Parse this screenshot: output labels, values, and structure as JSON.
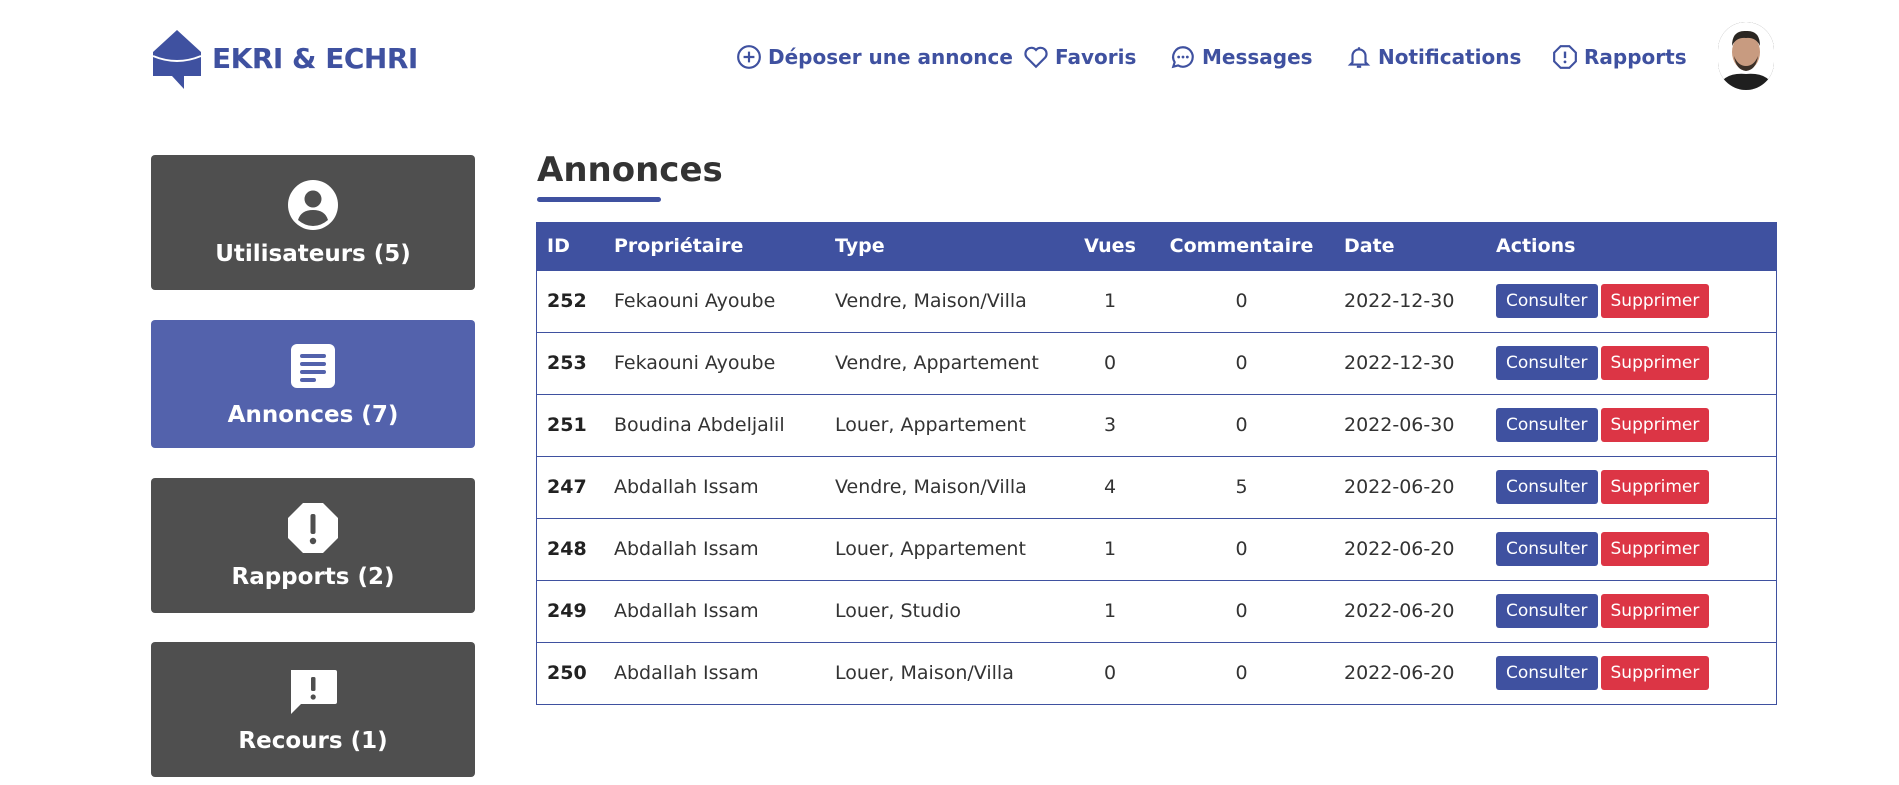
{
  "brand": {
    "name": "EKRI & ECHRI",
    "color": "#3f51a0"
  },
  "nav": [
    {
      "label": "Déposer une annonce",
      "icon": "plus-circle-icon"
    },
    {
      "label": "Favoris",
      "icon": "heart-icon"
    },
    {
      "label": "Messages",
      "icon": "chat-dots-icon"
    },
    {
      "label": "Notifications",
      "icon": "bell-icon"
    },
    {
      "label": "Rapports",
      "icon": "exclamation-octagon-icon"
    }
  ],
  "sidebar": [
    {
      "label": "Utilisateurs (5)",
      "icon": "user-circle-icon",
      "active": false
    },
    {
      "label": "Annonces (7)",
      "icon": "document-icon",
      "active": true
    },
    {
      "label": "Rapports (2)",
      "icon": "exclamation-octagon-icon",
      "active": false
    },
    {
      "label": "Recours (1)",
      "icon": "chat-alert-icon",
      "active": false
    }
  ],
  "main": {
    "title": "Annonces",
    "columns": [
      "ID",
      "Propriétaire",
      "Type",
      "Vues",
      "Commentaire",
      "Date",
      "Actions"
    ],
    "actions": {
      "view": "Consulter",
      "delete": "Supprimer"
    },
    "rows": [
      {
        "id": "252",
        "owner": "Fekaouni Ayoube",
        "type": "Vendre, Maison/Villa",
        "views": "1",
        "comments": "0",
        "date": "2022-12-30"
      },
      {
        "id": "253",
        "owner": "Fekaouni Ayoube",
        "type": "Vendre, Appartement",
        "views": "0",
        "comments": "0",
        "date": "2022-12-30"
      },
      {
        "id": "251",
        "owner": "Boudina Abdeljalil",
        "type": "Louer, Appartement",
        "views": "3",
        "comments": "0",
        "date": "2022-06-30"
      },
      {
        "id": "247",
        "owner": "Abdallah Issam",
        "type": "Vendre, Maison/Villa",
        "views": "4",
        "comments": "5",
        "date": "2022-06-20"
      },
      {
        "id": "248",
        "owner": "Abdallah Issam",
        "type": "Louer, Appartement",
        "views": "1",
        "comments": "0",
        "date": "2022-06-20"
      },
      {
        "id": "249",
        "owner": "Abdallah Issam",
        "type": "Louer, Studio",
        "views": "1",
        "comments": "0",
        "date": "2022-06-20"
      },
      {
        "id": "250",
        "owner": "Abdallah Issam",
        "type": "Louer, Maison/Villa",
        "views": "0",
        "comments": "0",
        "date": "2022-06-20"
      }
    ]
  }
}
